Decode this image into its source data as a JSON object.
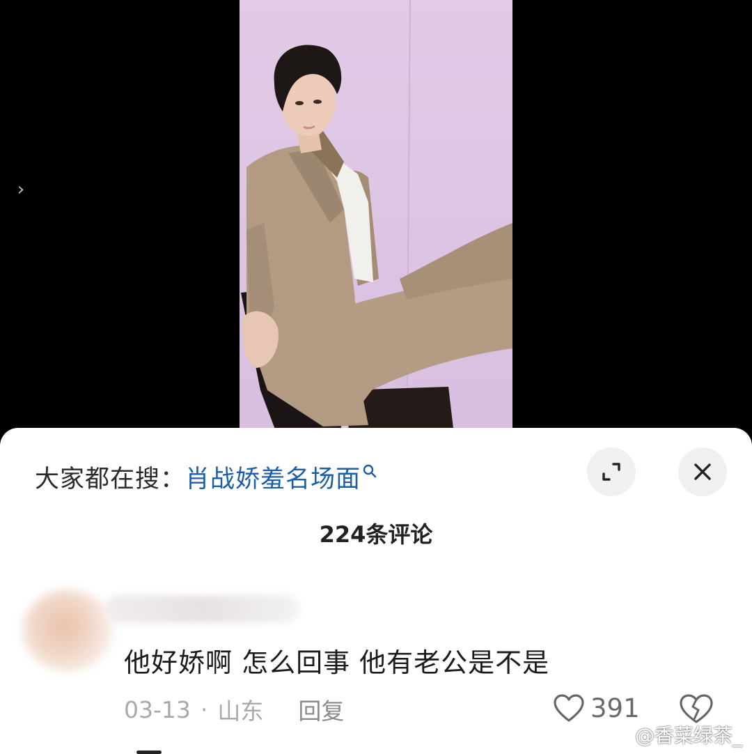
{
  "video": {
    "next_icon": "chevron-right-icon",
    "next_glyph": "›"
  },
  "sheet": {
    "search_prefix": "大家都在搜：",
    "search_term": "肖战娇羞名场面",
    "search_icon": "search-icon",
    "expand_icon": "expand-icon",
    "close_icon": "close-icon",
    "comment_count": "224条评论"
  },
  "comment": {
    "text": "他好娇啊 怎么回事 他有老公是不是",
    "date": "03-13",
    "separator": "·",
    "location": "山东",
    "reply_label": "回复",
    "like_count": "391",
    "like_icon": "heart-outline-icon",
    "dislike_icon": "broken-heart-icon"
  },
  "watermark": {
    "text": "@香菜绿茶_",
    "logo_icon": "weibo-logo-icon"
  },
  "colors": {
    "link_blue": "#1d5ea8",
    "meta_gray": "#a9a9a9",
    "button_bg": "#f0f0f0"
  }
}
